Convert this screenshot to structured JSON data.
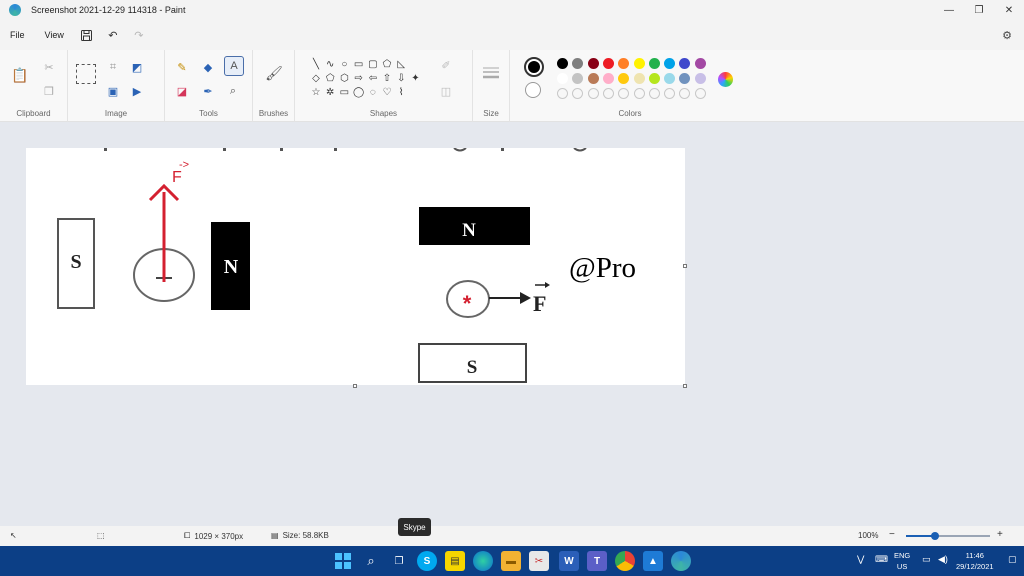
{
  "window": {
    "title": "Screenshot 2021-12-29 114318 - Paint",
    "controls": [
      "—",
      "❐",
      "✕"
    ]
  },
  "menu": {
    "file": "File",
    "view": "View",
    "save_icon": "save-icon",
    "undo_icon": "undo-icon",
    "redo_icon": "redo-icon"
  },
  "ribbon": {
    "groups": {
      "clipboard": "Clipboard",
      "image": "Image",
      "tools": "Tools",
      "brushes": "Brushes",
      "shapes": "Shapes",
      "size": "Size",
      "colors": "Colors"
    },
    "primary_color": "#000000",
    "secondary_color": "#ffffff",
    "palette_row1": [
      "#000000",
      "#7f7f7f",
      "#880015",
      "#ed1c24",
      "#ff7f27",
      "#fff200",
      "#22b14c",
      "#00a2e8",
      "#3f48cc",
      "#a349a4"
    ],
    "palette_row2": [
      "#ffffff",
      "#c3c3c3",
      "#b97a57",
      "#ffaec9",
      "#ffc90e",
      "#efe4b0",
      "#b5e61d",
      "#99d9ea",
      "#7092be",
      "#c8bfe7"
    ]
  },
  "canvas": {
    "left_magnet_south": "S",
    "left_magnet_north": "N",
    "left_force_label": "F",
    "left_force_arrowhead": "->",
    "right_magnet_north": "N",
    "right_magnet_south": "S",
    "right_force_label": "F",
    "current_into_page": "*",
    "watermark": "@Pro"
  },
  "status": {
    "dimensions": "1029 × 370px",
    "size": "Size: 58.8KB",
    "zoom": "100%",
    "zoom_level": 0.35
  },
  "tooltip": "Skype",
  "tray": {
    "lang": "ENG",
    "region": "US",
    "time": "11:46",
    "date": "29/12/2021"
  }
}
